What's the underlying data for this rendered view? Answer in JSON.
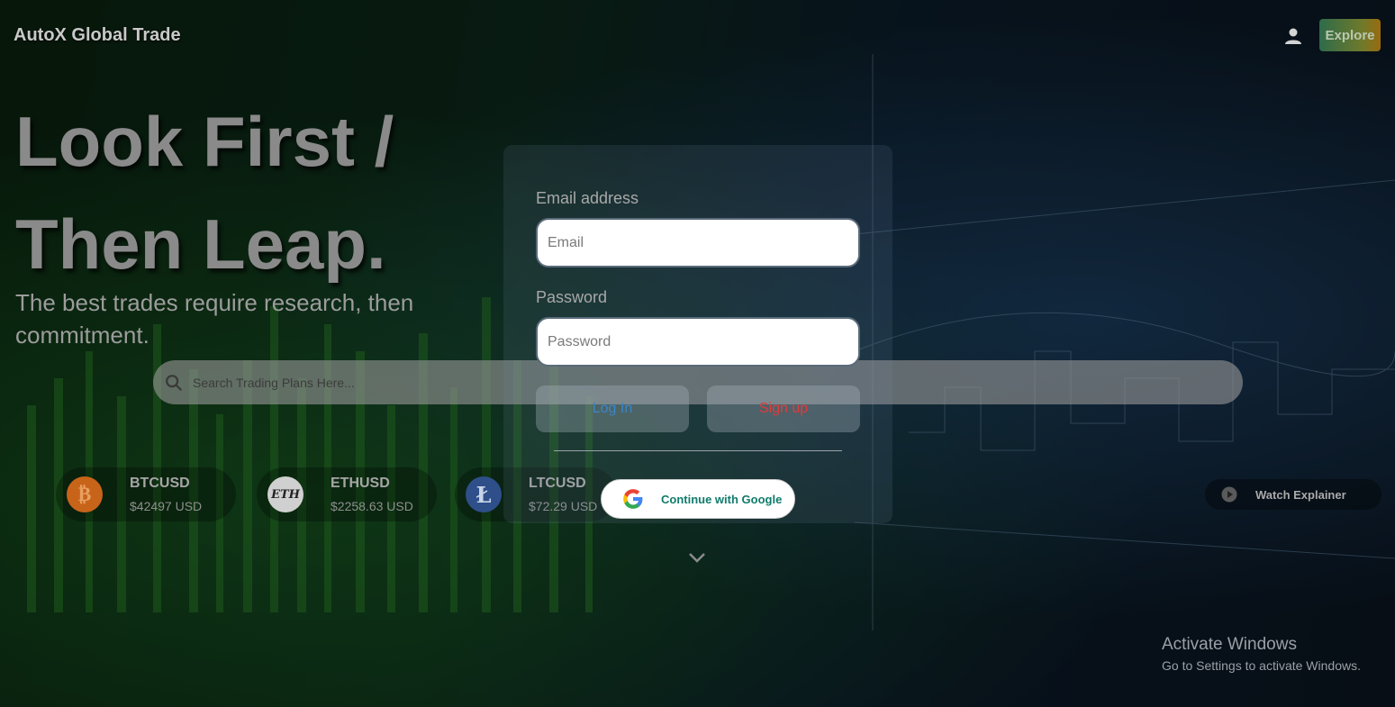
{
  "header": {
    "brand": "AutoX Global Trade",
    "explore_label": "Explore",
    "user_icon": "person-icon"
  },
  "hero": {
    "title_line1": "Look First /",
    "title_line2": "Then Leap.",
    "subtitle": "The best trades require research, then commitment."
  },
  "search": {
    "placeholder": "Search Trading Plans Here..."
  },
  "tickers": [
    {
      "symbol": "BTCUSD",
      "price": "$42497 USD",
      "icon": "bitcoin-icon",
      "glyph": "₿",
      "color": "#c8641a"
    },
    {
      "symbol": "ETHUSD",
      "price": "$2258.63 USD",
      "icon": "ethereum-icon",
      "glyph": "ETH",
      "color": "#d0d0d0"
    },
    {
      "symbol": "LTCUSD",
      "price": "$72.29 USD",
      "icon": "litecoin-icon",
      "glyph": "Ł",
      "color": "#2f4f8a"
    }
  ],
  "login": {
    "email_label": "Email address",
    "email_placeholder": "Email",
    "password_label": "Password",
    "password_placeholder": "Password",
    "login_label": "Log In",
    "signup_label": "Sign up",
    "google_label": "Continue with Google"
  },
  "watch": {
    "label": "Watch Explainer"
  },
  "windows_notice": {
    "title": "Activate Windows",
    "subtitle": "Go to Settings to activate Windows."
  },
  "colors": {
    "login_text": "#3a86c8",
    "signup_text": "#e03b3b",
    "google_text": "#0f7b6c"
  }
}
